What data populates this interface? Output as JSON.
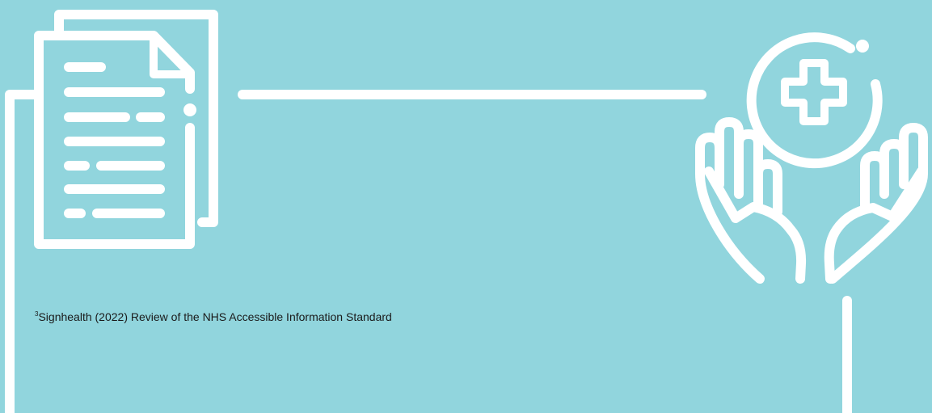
{
  "colors": {
    "background": "#91d5dd",
    "stroke": "#ffffff",
    "text": "#1a1a1a"
  },
  "icons": [
    "document-icon",
    "healthcare-hands-icon"
  ],
  "footnote": {
    "marker": "3",
    "text": "Signhealth (2022) Review of the NHS Accessible Information Standard"
  }
}
